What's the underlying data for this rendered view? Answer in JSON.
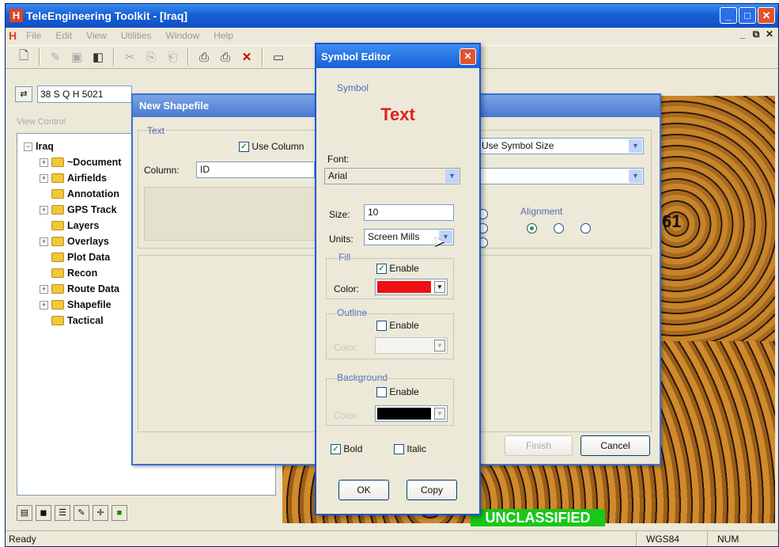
{
  "app": {
    "title": "TeleEngineering Toolkit - [Iraq]",
    "menu": [
      "File",
      "Edit",
      "View",
      "Utilities",
      "Window",
      "Help"
    ],
    "coord_value": "38 S Q H 5021",
    "view_label": "View Control"
  },
  "tree": {
    "root": "Iraq",
    "items": [
      {
        "label": "~Document",
        "expandable": true
      },
      {
        "label": "Airfields",
        "expandable": true
      },
      {
        "label": "Annotation",
        "expandable": false
      },
      {
        "label": "GPS Track",
        "expandable": true
      },
      {
        "label": "Layers",
        "expandable": false
      },
      {
        "label": "Overlays",
        "expandable": true
      },
      {
        "label": "Plot Data",
        "expandable": false
      },
      {
        "label": "Recon",
        "expandable": false
      },
      {
        "label": "Route Data",
        "expandable": true
      },
      {
        "label": "Shapefile",
        "expandable": true
      },
      {
        "label": "Tactical",
        "expandable": false
      }
    ]
  },
  "map": {
    "classification": "UNCLASSIFIED",
    "label_1": "61"
  },
  "status": {
    "ready": "Ready",
    "datum": "WGS84",
    "num": "NUM"
  },
  "shapefile_dialog": {
    "title": "New Shapefile",
    "text_group": "Text",
    "use_column": "Use Column",
    "column_label": "Column:",
    "column_value": "ID",
    "size_option": "Use Symbol Size",
    "alignment_label": "Alignment",
    "finish": "Finish",
    "cancel": "Cancel"
  },
  "symbol_editor": {
    "title": "Symbol Editor",
    "symbol_group": "Symbol",
    "preview": "Text",
    "font_label": "Font:",
    "font_value": "Arial",
    "size_label": "Size:",
    "size_value": "10",
    "units_label": "Units:",
    "units_value": "Screen Mills",
    "fill_group": "Fill",
    "fill_enable": "Enable",
    "color_label": "Color:",
    "fill_color": "#ee1111",
    "outline_group": "Outline",
    "outline_enable": "Enable",
    "outline_color_label": "Color:",
    "background_group": "Background",
    "background_enable": "Enable",
    "background_color_label": "Color:",
    "background_color": "#000000",
    "bold": "Bold",
    "italic": "Italic",
    "ok": "OK",
    "copy": "Copy"
  }
}
